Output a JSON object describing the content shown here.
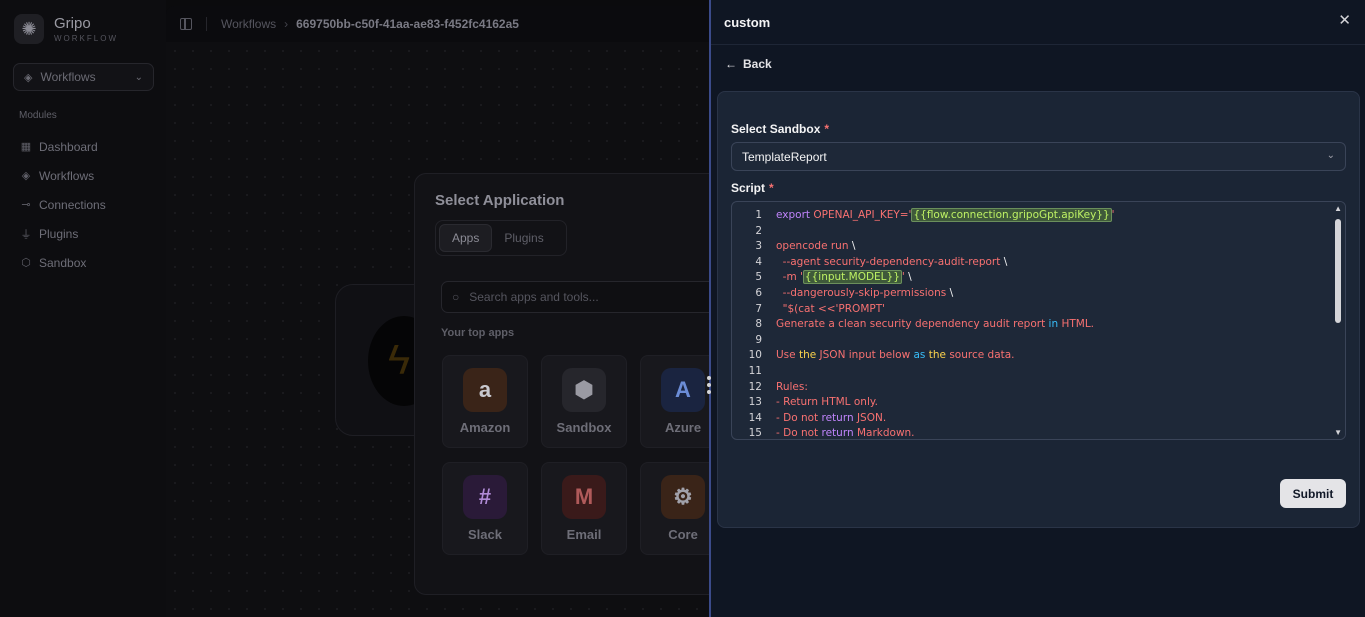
{
  "brand": {
    "name": "Gripo",
    "sub": "WORKFLOW"
  },
  "workspace_select": {
    "label": "Workflows"
  },
  "sidebar": {
    "section_label": "Modules",
    "items": [
      {
        "label": "Dashboard",
        "icon": "grid-icon"
      },
      {
        "label": "Workflows",
        "icon": "layers-icon"
      },
      {
        "label": "Connections",
        "icon": "link-icon"
      },
      {
        "label": "Plugins",
        "icon": "plug-icon"
      },
      {
        "label": "Sandbox",
        "icon": "cube-icon"
      }
    ]
  },
  "breadcrumb": {
    "root": "Workflows",
    "current": "669750bb-c50f-41aa-ae83-f452fc4162a5"
  },
  "app_modal": {
    "title": "Select Application",
    "tabs": [
      "Apps",
      "Plugins"
    ],
    "search_placeholder": "Search apps and tools...",
    "top_apps_label": "Your top apps",
    "apps": [
      {
        "name": "Amazon",
        "glyph": "a",
        "bg": "#3a2418"
      },
      {
        "name": "Sandbox",
        "glyph": "⬢",
        "bg": "#26262c"
      },
      {
        "name": "Azure",
        "glyph": "A",
        "bg": "#1a2440"
      },
      {
        "name": "Slack",
        "glyph": "#",
        "bg": "#2a1a38"
      },
      {
        "name": "Email",
        "glyph": "M",
        "bg": "#3a1a1a"
      },
      {
        "name": "Core",
        "glyph": "⚙",
        "bg": "#3a2418"
      }
    ]
  },
  "panel": {
    "title": "custom",
    "back_label": "Back",
    "sandbox_label": "Select Sandbox",
    "sandbox_value": "TemplateReport",
    "script_label": "Script",
    "submit_label": "Submit",
    "code": [
      {
        "n": "1",
        "text": "export OPENAI_API_KEY='{{flow.connection.gripoGpt.apiKey}}'"
      },
      {
        "n": "2",
        "text": ""
      },
      {
        "n": "3",
        "text": "opencode run \\"
      },
      {
        "n": "4",
        "text": "  --agent security-dependency-audit-report \\"
      },
      {
        "n": "5",
        "text": "  -m '{{input.MODEL}}' \\"
      },
      {
        "n": "6",
        "text": "  --dangerously-skip-permissions \\"
      },
      {
        "n": "7",
        "text": "  \"$(cat <<'PROMPT'"
      },
      {
        "n": "8",
        "text": "Generate a clean security dependency audit report in HTML."
      },
      {
        "n": "9",
        "text": ""
      },
      {
        "n": "10",
        "text": "Use the JSON input below as the source data."
      },
      {
        "n": "11",
        "text": ""
      },
      {
        "n": "12",
        "text": "Rules:"
      },
      {
        "n": "13",
        "text": "- Return HTML only."
      },
      {
        "n": "14",
        "text": "- Do not return JSON."
      },
      {
        "n": "15",
        "text": "- Do not return Markdown."
      }
    ]
  },
  "colors": {
    "accent_divider": "#3b4b8a",
    "panel_bg": "#0f1623",
    "card_bg": "#1b2535",
    "required": "#f87171"
  }
}
